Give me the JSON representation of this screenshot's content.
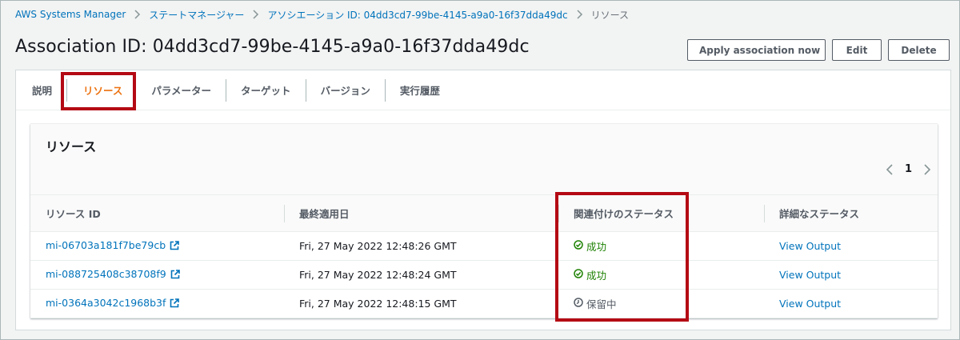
{
  "breadcrumb": {
    "items": [
      "AWS Systems Manager",
      "ステートマネージャー",
      "アソシエーション ID: 04dd3cd7-99be-4145-a9a0-16f37dda49dc",
      "リソース"
    ]
  },
  "page": {
    "title": "Association ID: 04dd3cd7-99be-4145-a9a0-16f37dda49dc"
  },
  "actions": {
    "apply": "Apply association now",
    "edit": "Edit",
    "delete": "Delete"
  },
  "tabs": [
    "説明",
    "リソース",
    "パラメーター",
    "ターゲット",
    "バージョン",
    "実行履歴"
  ],
  "active_tab": "リソース",
  "resources": {
    "title": "リソース",
    "page": "1",
    "columns": [
      "リソース ID",
      "最終適用日",
      "関連付けのステータス",
      "詳細なステータス"
    ],
    "rows": [
      {
        "id": "mi-06703a181f7be79cb",
        "date": "Fri, 27 May 2022 12:48:26 GMT",
        "status": "成功",
        "status_type": "success",
        "detail": "View Output"
      },
      {
        "id": "mi-088725408c38708f9",
        "date": "Fri, 27 May 2022 12:48:24 GMT",
        "status": "成功",
        "status_type": "success",
        "detail": "View Output"
      },
      {
        "id": "mi-0364a3042c1968b3f",
        "date": "Fri, 27 May 2022 12:48:15 GMT",
        "status": "保留中",
        "status_type": "pending",
        "detail": "View Output"
      }
    ]
  },
  "colors": {
    "link": "#0073bb",
    "active_tab": "#ec7211",
    "success": "#1d8102",
    "highlight": "#b40a14"
  },
  "icons": [
    "chevron-right-icon",
    "external-link-icon",
    "check-circle-icon",
    "clock-icon",
    "chevron-left-icon"
  ]
}
